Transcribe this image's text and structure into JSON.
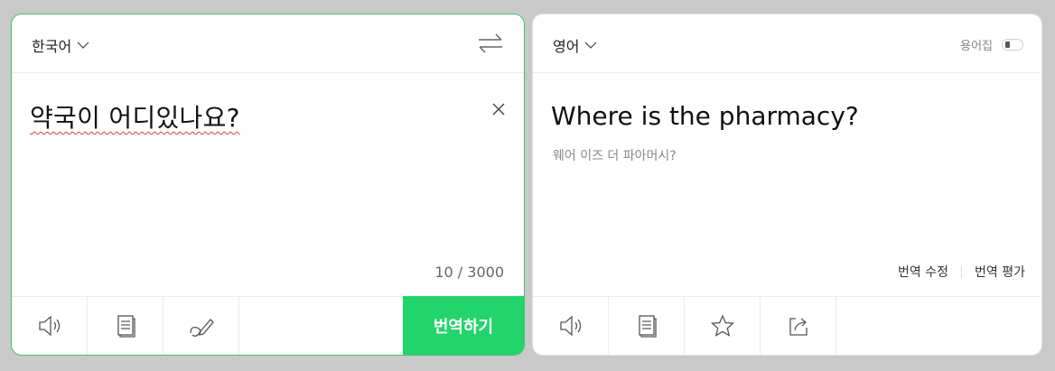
{
  "source": {
    "language": "한국어",
    "text": "약국이 어디있나요?",
    "char_count": "10 / 3000",
    "translate_button": "번역하기"
  },
  "target": {
    "language": "영어",
    "glossary_label": "용어집",
    "text": "Where is the pharmacy?",
    "pronunciation": "웨어 이즈 더 파아머시?",
    "edit_label": "번역 수정",
    "rate_label": "번역 평가"
  },
  "colors": {
    "accent": "#22d56b",
    "active_border": "#3cc46a",
    "background": "#c9c9c9"
  },
  "icons": {
    "source_tools": [
      "speaker-icon",
      "copy-icon",
      "handwriting-icon"
    ],
    "target_tools": [
      "speaker-icon",
      "copy-icon",
      "star-icon",
      "share-icon"
    ]
  }
}
